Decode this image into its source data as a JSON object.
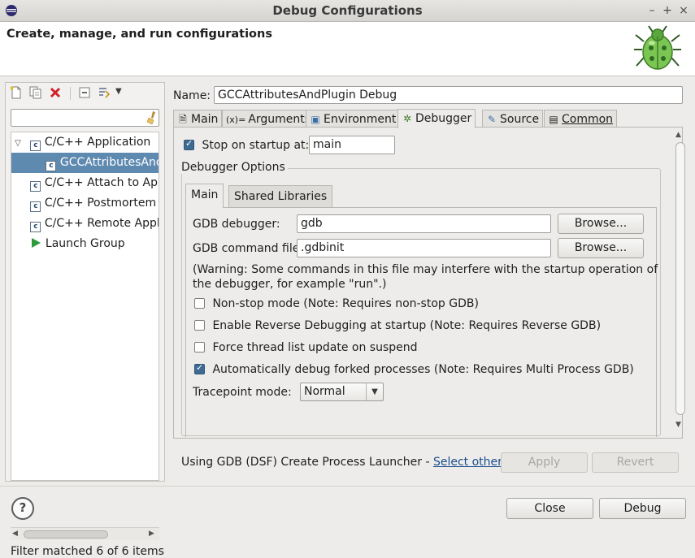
{
  "window": {
    "title": "Debug Configurations",
    "controls": {
      "minimize": "–",
      "maximize": "+",
      "close": "×"
    }
  },
  "header": {
    "title": "Create, manage, and run configurations",
    "icon": "debug-bug-icon"
  },
  "left_toolbar": {
    "icons": [
      "new-launch-config-icon",
      "duplicate-icon",
      "delete-icon",
      "collapse-all-icon",
      "filter-icon",
      "dropdown-icon"
    ]
  },
  "filter": {
    "value": "",
    "placeholder": ""
  },
  "tree": {
    "items": [
      {
        "label": "C/C++ Application",
        "expanded": true,
        "level": 0
      },
      {
        "label": "GCCAttributesAndPluginDebug",
        "level": 1,
        "selected": true
      },
      {
        "label": "C/C++ Attach to Application",
        "level": 0
      },
      {
        "label": "C/C++ Postmortem Debugger",
        "level": 0
      },
      {
        "label": "C/C++ Remote Application",
        "level": 0
      },
      {
        "label": "Launch Group",
        "level": 0
      }
    ]
  },
  "filter_status": "Filter matched 6 of 6 items",
  "name_label": "Name:",
  "name_value": "GCCAttributesAndPlugin Debug",
  "tabs": [
    {
      "label": "Main",
      "icon": "main-tab-icon"
    },
    {
      "label": "Arguments",
      "icon": "arguments-tab-icon",
      "icon_text": "(x)="
    },
    {
      "label": "Environment",
      "icon": "environment-tab-icon"
    },
    {
      "label": "Debugger",
      "icon": "debugger-tab-icon",
      "active": true
    },
    {
      "label": "Source",
      "icon": "source-tab-icon"
    },
    {
      "label": "Common",
      "icon": "common-tab-icon"
    }
  ],
  "debugger": {
    "stop_on_startup_label": "Stop on startup at:",
    "stop_on_startup_checked": true,
    "stop_on_startup_value": "main",
    "options_group_label": "Debugger Options",
    "subtabs": [
      {
        "label": "Main",
        "active": true
      },
      {
        "label": "Shared Libraries"
      }
    ],
    "gdb_debugger_label": "GDB debugger:",
    "gdb_debugger_value": "gdb",
    "gdb_command_file_label": "GDB command file:",
    "gdb_command_file_value": ".gdbinit",
    "browse_label": "Browse...",
    "warning_line1": "(Warning: Some commands in this file may interfere with the startup operation of",
    "warning_line2": "the debugger, for example \"run\".)",
    "non_stop_label": "Non-stop mode (Note: Requires non-stop GDB)",
    "non_stop_checked": false,
    "reverse_label": "Enable Reverse Debugging at startup (Note: Requires Reverse GDB)",
    "reverse_checked": false,
    "force_thread_label": "Force thread list update on suspend",
    "force_thread_checked": false,
    "auto_fork_label": "Automatically debug forked processes (Note: Requires Multi Process GDB)",
    "auto_fork_checked": true,
    "tracepoint_label": "Tracepoint mode:",
    "tracepoint_value": "Normal"
  },
  "launcher": {
    "text": "Using GDB (DSF) Create Process Launcher - ",
    "link": "Select other..."
  },
  "buttons": {
    "apply": "Apply",
    "revert": "Revert",
    "close": "Close",
    "debug": "Debug",
    "help": "?"
  },
  "colors": {
    "selection": "#5f8ab0",
    "link": "#1a4d8f",
    "delete_icon": "#d0202a",
    "launch_group_icon": "#2e9a3a"
  }
}
